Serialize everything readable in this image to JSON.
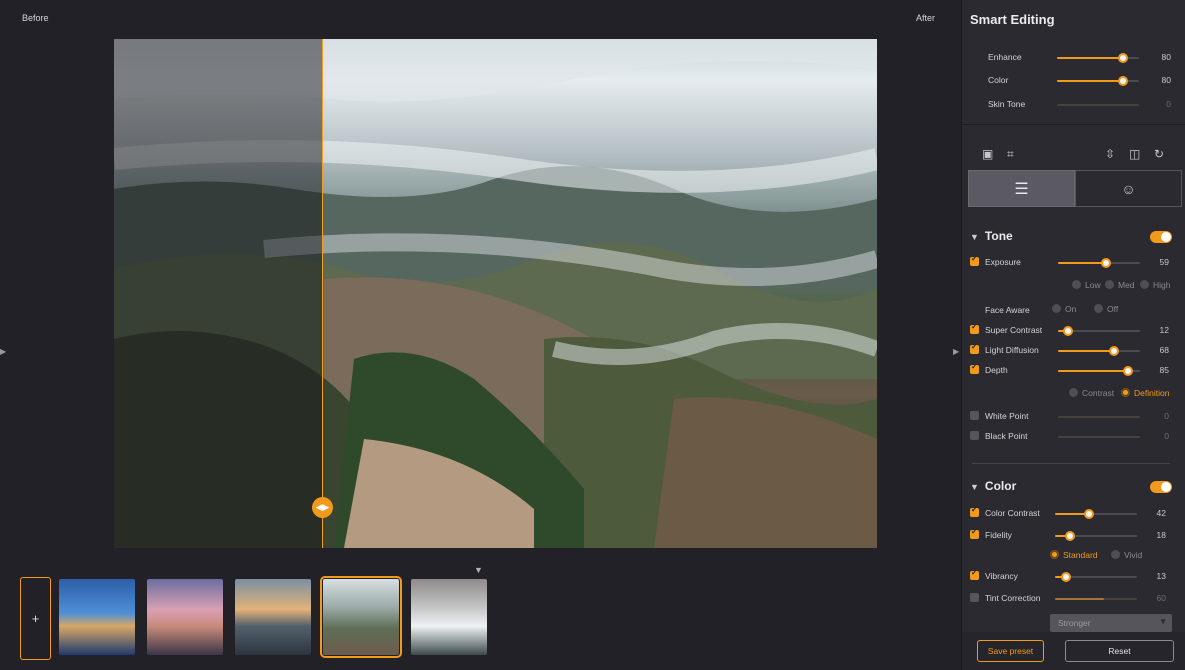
{
  "preview": {
    "before_label": "Before",
    "after_label": "After",
    "split_handle_icon": "split-compare-handle-icon"
  },
  "filmstrip": {
    "add_label": "+",
    "thumbnails": [
      {
        "name": "venice-canals"
      },
      {
        "name": "dubai-skyline"
      },
      {
        "name": "city-sunset"
      },
      {
        "name": "misty-mountain-village",
        "selected": true
      },
      {
        "name": "waterfall-snow"
      }
    ]
  },
  "panel": {
    "title": "Smart Editing",
    "smart": [
      {
        "label": "Enhance",
        "value": "80",
        "level": 80,
        "enabled": true
      },
      {
        "label": "Color",
        "value": "80",
        "level": 80,
        "enabled": true
      },
      {
        "label": "Skin Tone",
        "value": "0",
        "level": 0,
        "enabled": false
      }
    ],
    "tools": [
      "image-icon",
      "crop-icon",
      "flip-vertical-icon",
      "flip-horizontal-icon",
      "rotate-icon"
    ],
    "tabs": [
      "adjustments-tab-icon",
      "portrait-tab-icon"
    ],
    "tone": {
      "title": "Tone",
      "enabled": true,
      "exposure": {
        "label": "Exposure",
        "value": "59",
        "level": 59,
        "checked": true
      },
      "exposure_options": [
        "Low",
        "Med",
        "High"
      ],
      "face_aware": {
        "label": "Face Aware",
        "options": [
          "On",
          "Off"
        ]
      },
      "super_contrast": {
        "label": "Super Contrast",
        "value": "12",
        "level": 12,
        "checked": true
      },
      "light_diffusion": {
        "label": "Light Diffusion",
        "value": "68",
        "level": 68,
        "checked": true
      },
      "depth": {
        "label": "Depth",
        "value": "85",
        "level": 85,
        "checked": true
      },
      "depth_options": [
        {
          "label": "Contrast",
          "selected": false
        },
        {
          "label": "Definition",
          "selected": true
        }
      ],
      "white_point": {
        "label": "White Point",
        "value": "0",
        "level": 0,
        "checked": false
      },
      "black_point": {
        "label": "Black Point",
        "value": "0",
        "level": 0,
        "checked": false
      }
    },
    "color": {
      "title": "Color",
      "enabled": true,
      "color_contrast": {
        "label": "Color Contrast",
        "value": "42",
        "level": 42,
        "checked": true
      },
      "fidelity": {
        "label": "Fidelity",
        "value": "18",
        "level": 18,
        "checked": true
      },
      "fidelity_options": [
        {
          "label": "Standard",
          "selected": true
        },
        {
          "label": "Vivid",
          "selected": false
        }
      ],
      "vibrancy": {
        "label": "Vibrancy",
        "value": "13",
        "level": 13,
        "checked": true
      },
      "tint_correction": {
        "label": "Tint Correction",
        "value": "60",
        "level": 60,
        "checked": false
      },
      "tint_mode": "Stronger"
    },
    "footer": {
      "save_preset": "Save preset",
      "reset": "Reset"
    }
  },
  "colors": {
    "accent": "#f29a1b",
    "background": "#222127",
    "panel": "#2b2a30"
  }
}
